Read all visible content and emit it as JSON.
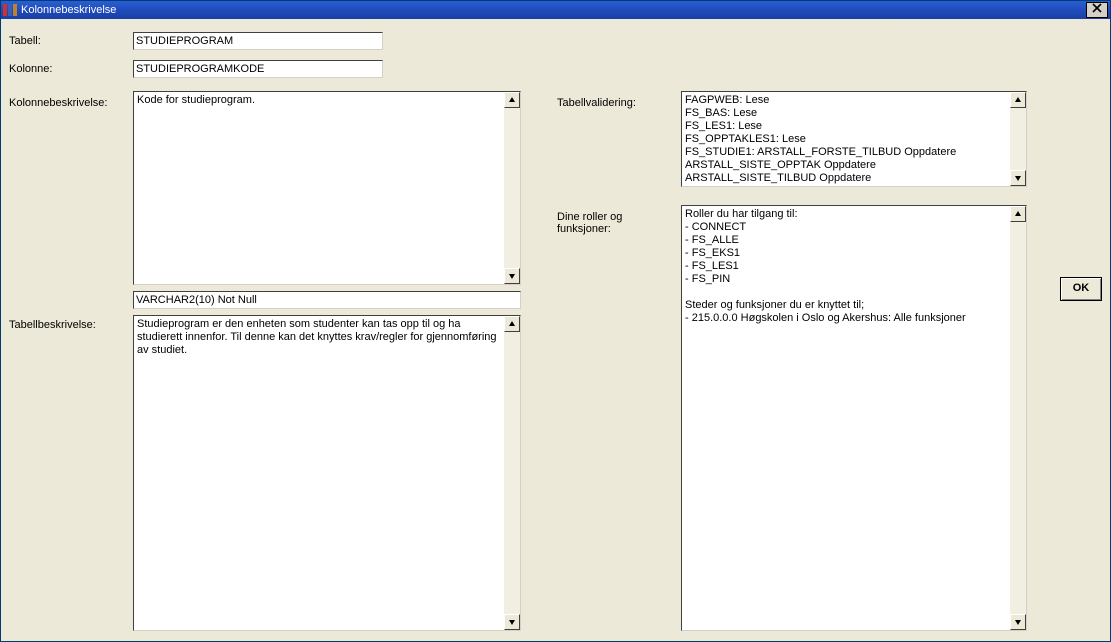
{
  "window": {
    "title": "Kolonnebeskrivelse"
  },
  "labels": {
    "table": "Tabell:",
    "column": "Kolonne:",
    "col_desc": "Kolonnebeskrivelse:",
    "tbl_desc": "Tabellbeskrivelse:",
    "tbl_valid": "Tabellvalidering:",
    "roles": "Dine roller og funksjoner:"
  },
  "values": {
    "table": "STUDIEPROGRAM",
    "column": "STUDIEPROGRAMKODE",
    "datatype": "VARCHAR2(10) Not Null",
    "col_desc": "Kode for studieprogram.",
    "tbl_desc": "Studieprogram er den enheten som studenter kan tas opp til og ha studierett innenfor. Til denne kan det knyttes krav/regler for gjennomføring av studiet.",
    "tbl_valid": "FAGPWEB: Lese\nFS_BAS: Lese\nFS_LES1: Lese\nFS_OPPTAKLES1: Lese\nFS_STUDIE1: ARSTALL_FORSTE_TILBUD Oppdatere\nARSTALL_SISTE_OPPTAK Oppdatere ARSTALL_SISTE_TILBUD Oppdatere",
    "roles": "Roller du har tilgang til:\n- CONNECT\n- FS_ALLE\n- FS_EKS1\n- FS_LES1\n- FS_PIN\n\nSteder og funksjoner du er knyttet til;\n- 215.0.0.0 Høgskolen i Oslo og Akershus: Alle funksjoner"
  },
  "buttons": {
    "ok": "OK",
    "close_x": "✕"
  }
}
